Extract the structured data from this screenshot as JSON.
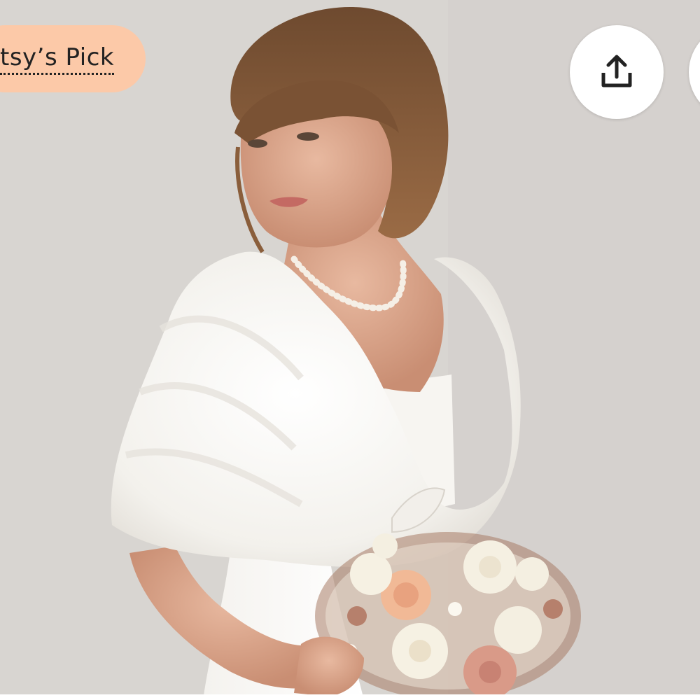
{
  "listing_image": {
    "badge": {
      "label": "tsy’s Pick",
      "background": "#fcc9a8"
    },
    "actions": {
      "share_icon": "share-upload-icon",
      "next_icon": "circle-button"
    },
    "alt": ""
  }
}
